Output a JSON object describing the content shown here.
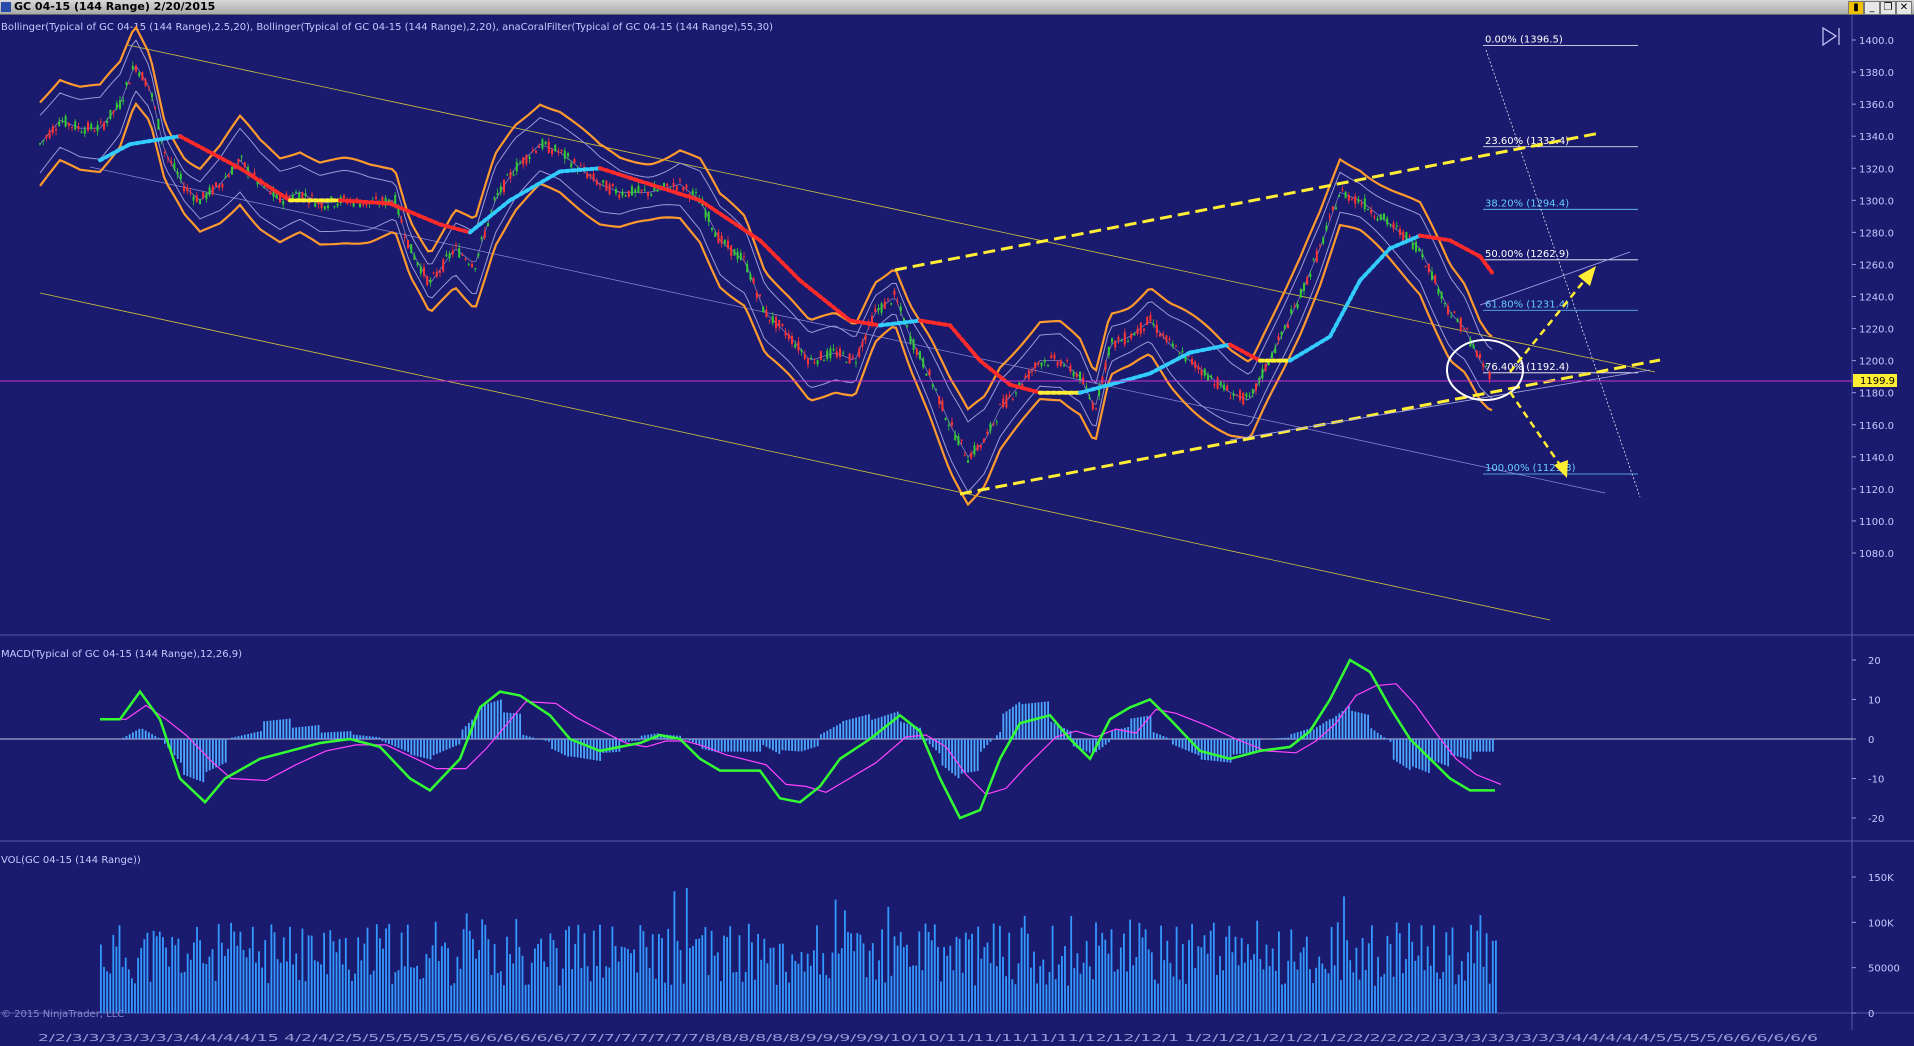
{
  "window": {
    "title": "GC 04-15 (144 Range)  2/20/2015",
    "buttons": [
      "_",
      "❐",
      "✕"
    ]
  },
  "panels": {
    "price": {
      "label": "Bollinger(Typical of GC 04-15 (144 Range),2.5,20), Bollinger(Typical of GC 04-15 (144 Range),2,20), anaCoralFilter(Typical of GC 04-15 (144 Range),55,30)",
      "yaxis_ticks": [
        "1400.0",
        "1380.0",
        "1360.0",
        "1340.0",
        "1320.0",
        "1300.0",
        "1280.0",
        "1260.0",
        "1240.0",
        "1220.0",
        "1200.0",
        "1180.0",
        "1160.0",
        "1140.0",
        "1120.0",
        "1100.0",
        "1080.0"
      ],
      "current_price": "1199.9",
      "fib_levels": [
        {
          "label": "0.00% (1396.5)",
          "value": 1396.5
        },
        {
          "label": "23.60% (1333.4)",
          "value": 1333.4
        },
        {
          "label": "38.20% (1294.4)",
          "value": 1294.4
        },
        {
          "label": "50.00% (1262.9)",
          "value": 1262.9
        },
        {
          "label": "61.80% (1231.4)",
          "value": 1231.4
        },
        {
          "label": "76.40% (1192.4)",
          "value": 1192.4
        },
        {
          "label": "100.00% (1129.3)",
          "value": 1129.3
        }
      ]
    },
    "macd": {
      "label": "MACD(Typical of GC 04-15 (144 Range),12,26,9)",
      "yaxis_ticks": [
        "20",
        "10",
        "0",
        "-10",
        "-20"
      ]
    },
    "volume": {
      "label": "VOL(GC 04-15 (144 Range))",
      "yaxis_ticks": [
        "150K",
        "100K",
        "50000",
        "0"
      ]
    }
  },
  "colors": {
    "background": "#1a1a6e",
    "bollinger_outer": "#ff9a2e",
    "coral_up": "#33ccff",
    "coral_down": "#ff2a2a",
    "coral_flat": "#ffee33",
    "trendline": "#ffee33",
    "macd": "#33ff33",
    "signal": "#ff44ff",
    "histogram": "#4da6ff",
    "volume": "#3399ff"
  },
  "copyright": "© 2015 NinjaTrader, LLC",
  "xaxis_labels": "2/2/3/3/3/3/3/3/3/4/4/4/4/15  4/2/4/2/5/5/5/5/5/5/5/6/6/6/6/6/6/7/7/7/7/7/7/7/7/8/8/8/8/8/8/9/9/9/9/9/10/10/11/11/11/11/11/12/12/12/1  1/2/1/2/1/2/1/2/1/2/2/2/2/2/2/3/3/3/3/3/3/3/3/4/4/4/4/4/5/5/5/5/6/6/6/6/6/6"
}
